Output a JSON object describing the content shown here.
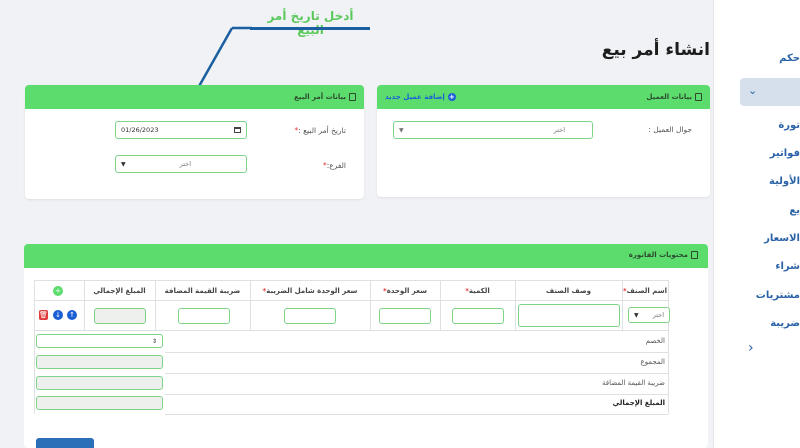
{
  "callout": {
    "text": "أدخل تاريخ أمر البيع"
  },
  "page": {
    "title": "انشاء أمر بيع"
  },
  "sidebar": {
    "items": [
      {
        "label": "حكم"
      },
      {
        "label": "تورة"
      },
      {
        "label": "فواتير"
      },
      {
        "label": "الأولية"
      },
      {
        "label": "يع"
      },
      {
        "label": "الاسعار"
      },
      {
        "label": "شراء"
      },
      {
        "label": "مشتريات"
      },
      {
        "label": "ضريبة"
      }
    ]
  },
  "customer_card": {
    "title": "بيانات العميل",
    "add_link": "إضافة عميل جديد",
    "phone_label": "جوال العميل :",
    "phone_select": "اختر"
  },
  "order_card": {
    "title": "بيانات أمر البيع",
    "date_label": "تاريخ أمر البيع :",
    "date_value": "01/26/2023",
    "branch_label": "الفرع:",
    "branch_select": "اختر"
  },
  "items_card": {
    "title": "محتويات الفاتورة",
    "columns": [
      "اسم الصنف",
      "وصف الصنف",
      "الكمية",
      "سعر الوحدة",
      "سعر الوحدة شامل الضريبة",
      "ضريبة القيمة المضافة",
      "المبلغ الإجمالي"
    ],
    "item_select": "اختر",
    "summary": {
      "discount": "الخصم",
      "subtotal": "المجموع",
      "vat": "ضريبة القيمة المضافة",
      "total": "المبلغ الإجمالي"
    }
  },
  "colors": {
    "header_green": "#5cdc6c",
    "input_border": "#7fd48a",
    "accent_blue": "#1b5fd6",
    "delete_red": "#e03b3b"
  }
}
